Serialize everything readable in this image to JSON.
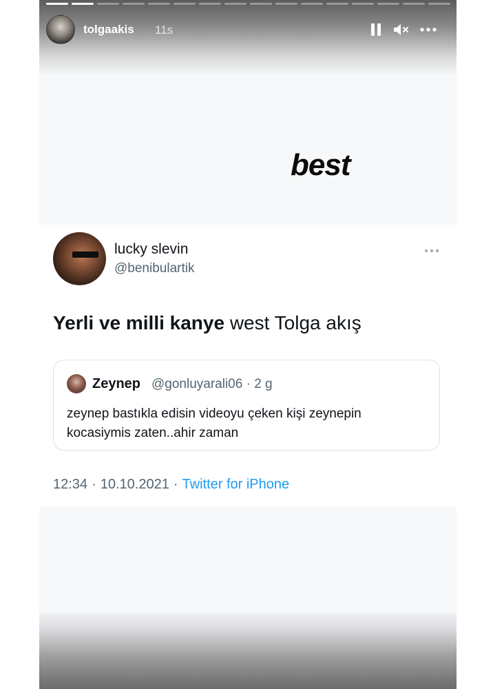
{
  "story": {
    "progress_segments_total": 16,
    "progress_segments_done": 2,
    "username": "tolgaakis",
    "time_ago": "11s",
    "icons": [
      "pause-icon",
      "mute-icon",
      "more-icon"
    ],
    "sticker_text": "best"
  },
  "tweet": {
    "display_name": "lucky slevin",
    "handle": "@benibulartik",
    "text_bold": "Yerli ve milli kanye",
    "text_rest": " west Tolga akış",
    "quote": {
      "name": "Zeynep",
      "meta": "@gonluyarali06 · 2 g",
      "text": "zeynep bastıkla edisin videoyu çeken kişi zeynepin kocasiymis zaten..ahir zaman"
    },
    "time": "12:34",
    "date": "10.10.2021",
    "separator": "·",
    "source": "Twitter for iPhone"
  },
  "colors": {
    "link_blue": "#1d9bf0",
    "secondary_text": "#536471",
    "primary_text": "#0f1419"
  }
}
